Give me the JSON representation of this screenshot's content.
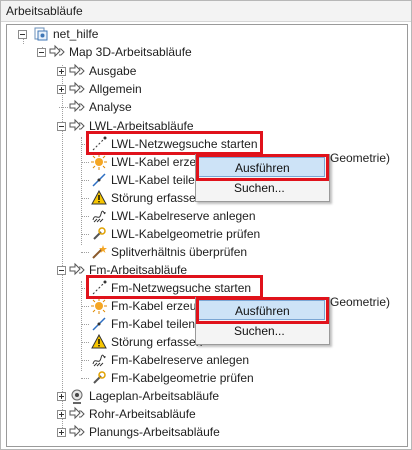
{
  "panel": {
    "title": "Arbeitsabläufe"
  },
  "tree": {
    "root": "net_hilfe",
    "map3d": "Map 3D-Arbeitsabläufe",
    "groups_top": [
      "Ausgabe",
      "Allgemein",
      "Analyse"
    ],
    "lwl": {
      "title": "LWL-Arbeitsabläufe",
      "items": [
        "LWL-Netzwegsuche starten",
        "LWL-Kabel erzeugen (Geometrie)",
        "LWL-Kabel teilen",
        "Störung erfassen",
        "LWL-Kabelreserve anlegen",
        "LWL-Kabelgeometrie prüfen",
        "Splitverhältnis überprüfen"
      ]
    },
    "fm": {
      "title": "Fm-Arbeitsabläufe",
      "items": [
        "Fm-Netzwegsuche starten",
        "Fm-Kabel erzeugen (Geometrie)",
        "Fm-Kabel teilen",
        "Störung erfassen",
        "Fm-Kabelreserve anlegen",
        "Fm-Kabelgeometrie prüfen"
      ]
    },
    "groups_bottom": [
      "Lageplan-Arbeitsabläufe",
      "Rohr-Arbeitsabläufe",
      "Planungs-Arbeitsabläufe"
    ],
    "obscured_suffix_1": "Geometrie)",
    "obscured_suffix_2": "Geometrie)"
  },
  "menu1": {
    "items": [
      "Ausführen",
      "Suchen..."
    ]
  },
  "menu2": {
    "items": [
      "Ausführen",
      "Suchen..."
    ]
  },
  "colors": {
    "highlight": "#e0121b",
    "menu_selected": "#cde3f7",
    "menu_selected_border": "#7aa6d4"
  }
}
